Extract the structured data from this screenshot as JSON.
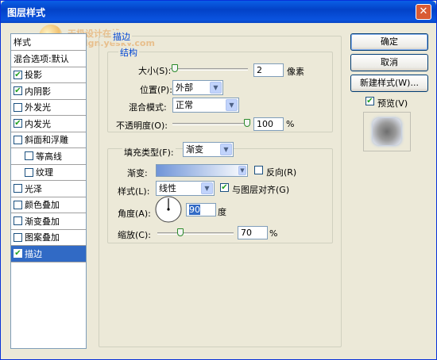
{
  "window": {
    "title": "图层样式",
    "close_glyph": "✕"
  },
  "watermark": {
    "line1": "天极设计在线",
    "line2": "design.yesky.com"
  },
  "sidebar": {
    "items": [
      {
        "label": "样式",
        "check": "none",
        "indent": false,
        "selected": false
      },
      {
        "label": "混合选项:默认",
        "check": "none",
        "indent": false,
        "selected": false
      },
      {
        "label": "投影",
        "check": "checked",
        "indent": false,
        "selected": false
      },
      {
        "label": "内阴影",
        "check": "checked",
        "indent": false,
        "selected": false
      },
      {
        "label": "外发光",
        "check": "unchecked",
        "indent": false,
        "selected": false
      },
      {
        "label": "内发光",
        "check": "checked",
        "indent": false,
        "selected": false
      },
      {
        "label": "斜面和浮雕",
        "check": "unchecked",
        "indent": false,
        "selected": false
      },
      {
        "label": "等高线",
        "check": "unchecked",
        "indent": true,
        "selected": false
      },
      {
        "label": "纹理",
        "check": "unchecked",
        "indent": true,
        "selected": false
      },
      {
        "label": "光泽",
        "check": "unchecked",
        "indent": false,
        "selected": false
      },
      {
        "label": "颜色叠加",
        "check": "unchecked",
        "indent": false,
        "selected": false
      },
      {
        "label": "渐变叠加",
        "check": "unchecked",
        "indent": false,
        "selected": false
      },
      {
        "label": "图案叠加",
        "check": "unchecked",
        "indent": false,
        "selected": false
      },
      {
        "label": "描边",
        "check": "checked",
        "indent": false,
        "selected": true
      }
    ]
  },
  "stroke": {
    "group_title": "描边",
    "structure_title": "结构",
    "size": {
      "label": "大小(S):",
      "value": "2",
      "unit": "像素",
      "level": 0.02
    },
    "position": {
      "label": "位置(P):",
      "value": "外部"
    },
    "blend_mode": {
      "label": "混合模式:",
      "value": "正常"
    },
    "opacity": {
      "label": "不透明度(O):",
      "value": "100",
      "unit": "%",
      "level": 1.0
    },
    "fill_type": {
      "label": "填充类型(F):",
      "value": "渐变"
    },
    "gradient": {
      "label": "渐变:",
      "start_color": "#6f94d8",
      "end_color": "#ffffff"
    },
    "reverse": {
      "label": "反向(R)",
      "checked": false
    },
    "style": {
      "label": "样式(L):",
      "value": "线性"
    },
    "align": {
      "label": "与图层对齐(G)",
      "checked": true
    },
    "angle": {
      "label": "角度(A):",
      "value": "90",
      "unit": "度"
    },
    "scale": {
      "label": "缩放(C):",
      "value": "70",
      "unit": "%",
      "level": 0.28
    }
  },
  "buttons": {
    "ok": "确定",
    "cancel": "取消",
    "new_style": "新建样式(W)...",
    "preview_label": "预览(V)",
    "preview_checked": true
  },
  "colors": {
    "accent": "#316ac5",
    "title_bar": "#0a5fe6",
    "check_mark": "#21a121"
  }
}
